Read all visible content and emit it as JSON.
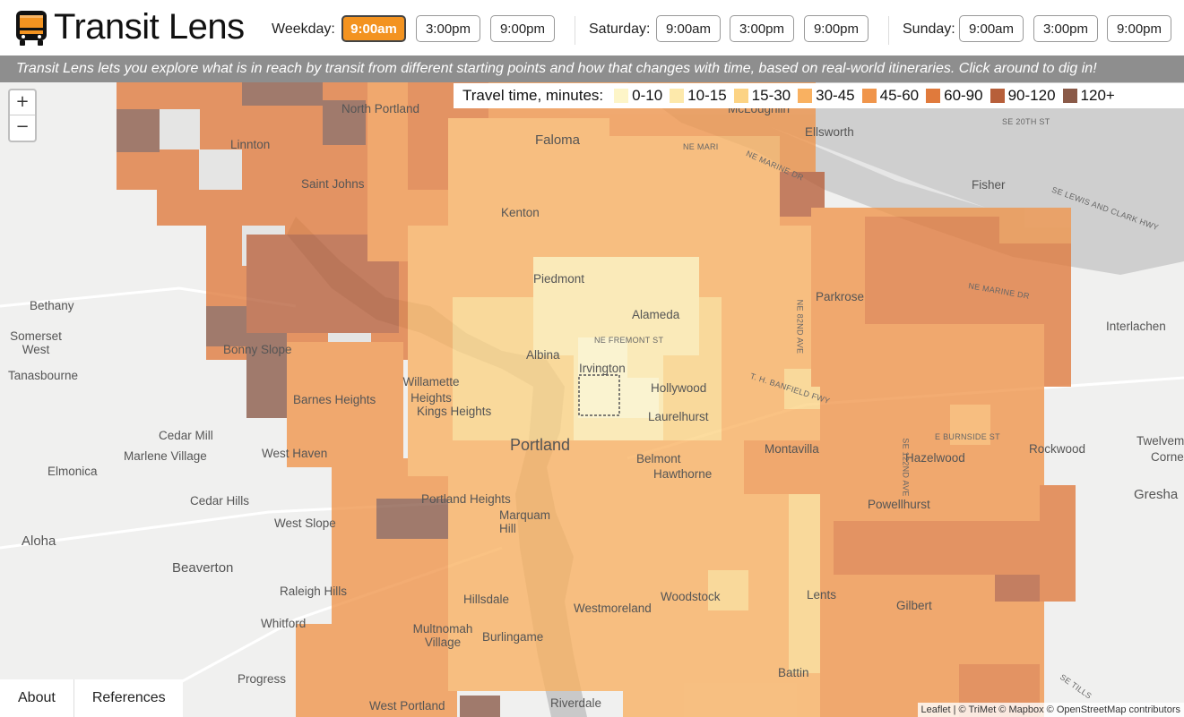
{
  "app": {
    "title": "Transit Lens"
  },
  "schedule": {
    "weekday": {
      "label": "Weekday:",
      "times": [
        "9:00am",
        "3:00pm",
        "9:00pm"
      ],
      "active_index": 0
    },
    "saturday": {
      "label": "Saturday:",
      "times": [
        "9:00am",
        "3:00pm",
        "9:00pm"
      ]
    },
    "sunday": {
      "label": "Sunday:",
      "times": [
        "9:00am",
        "3:00pm",
        "9:00pm"
      ]
    }
  },
  "banner": {
    "text": "Transit Lens lets you explore what is in reach by transit from different starting points and how that changes with time, based on real-world itineraries. Click around to dig in!"
  },
  "legend": {
    "title": "Travel time, minutes:",
    "items": [
      {
        "label": "0-10",
        "color": "#fdf5c8"
      },
      {
        "label": "10-15",
        "color": "#fde9ab"
      },
      {
        "label": "15-30",
        "color": "#fcd384"
      },
      {
        "label": "30-45",
        "color": "#f9b161"
      },
      {
        "label": "45-60",
        "color": "#f0954b"
      },
      {
        "label": "60-90",
        "color": "#e07a3c"
      },
      {
        "label": "90-120",
        "color": "#b75f3a"
      },
      {
        "label": "120+",
        "color": "#8a5a48"
      }
    ]
  },
  "map": {
    "zoom_in": "+",
    "zoom_out": "−",
    "places": [
      "North Portland",
      "Faloma",
      "Linnton",
      "Saint Johns",
      "Kenton",
      "Piedmont",
      "Alameda",
      "Albina",
      "Irvington",
      "Hollywood",
      "Laurelhurst",
      "Willamette Heights",
      "Kings Heights",
      "Portland",
      "Barnes Heights",
      "Bonny Slope",
      "Bethany",
      "Somerset West",
      "Tanasbourne",
      "Cedar Mill",
      "Marlene Village",
      "Elmonica",
      "Cedar Hills",
      "West Haven",
      "West Slope",
      "Aloha",
      "Beaverton",
      "Raleigh Hills",
      "Whitford",
      "Progress",
      "Portland Heights",
      "Marquam Hill",
      "Hillsdale",
      "Multnomah Village",
      "Burlingame",
      "Westmoreland",
      "West Portland",
      "Riverdale",
      "Belmont",
      "Hawthorne",
      "Montavilla",
      "Woodstock",
      "Lents",
      "Battin",
      "Parkrose",
      "Hazelwood",
      "Powellhurst",
      "Gilbert",
      "Rockwood",
      "Ellsworth",
      "Fisher",
      "Interlachen",
      "Twelvem",
      "Corne",
      "Gresha",
      "McLoughlin"
    ],
    "streets": [
      "NE FREMONT ST",
      "NE MARINE DR",
      "NE MARI",
      "SE LEWIS AND CLARK HWY",
      "NE 82ND AVE",
      "T. H. BANFIELD FWY",
      "E BURNSIDE ST",
      "SE 122ND AVE",
      "SE 20TH ST",
      "SE TILLS",
      "NE MARINE DR"
    ]
  },
  "bottom_tabs": [
    "About",
    "References"
  ],
  "attribution": "Leaflet | © TriMet © Mapbox © OpenStreetMap contributors"
}
